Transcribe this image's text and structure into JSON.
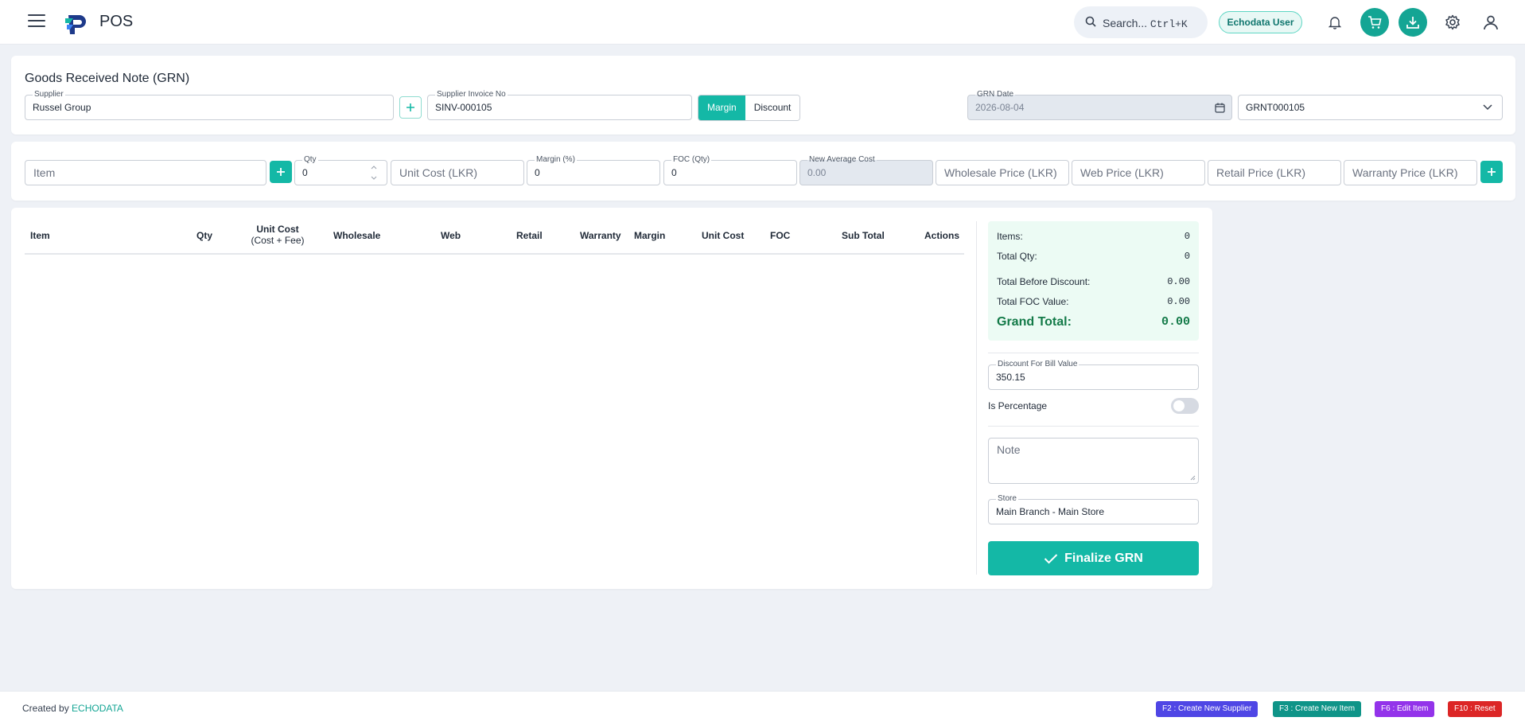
{
  "app": {
    "name": "POS"
  },
  "header": {
    "search_label": "Search...",
    "search_shortcut": "Ctrl+K",
    "user_name": "Echodata User"
  },
  "grn": {
    "title": "Goods Received Note (GRN)",
    "supplier": {
      "label": "Supplier",
      "value": "Russel Group"
    },
    "invoice": {
      "label": "Supplier Invoice No",
      "value": "SINV-000105"
    },
    "mode": {
      "options": [
        "Margin",
        "Discount"
      ],
      "selected": "Margin"
    },
    "date": {
      "label": "GRN Date",
      "value": "2026-08-04"
    },
    "grn_number": "GRNT000105"
  },
  "entry": {
    "item_placeholder": "Item",
    "qty": {
      "label": "Qty",
      "value": "0"
    },
    "unit_cost_placeholder": "Unit Cost (LKR)",
    "margin": {
      "label": "Margin (%)",
      "value": "0"
    },
    "foc": {
      "label": "FOC (Qty)",
      "value": "0"
    },
    "new_avg_cost": {
      "label": "New Average Cost",
      "value": "0.00"
    },
    "wholesale_placeholder": "Wholesale Price (LKR)",
    "web_placeholder": "Web Price (LKR)",
    "retail_placeholder": "Retail Price (LKR)",
    "warranty_placeholder": "Warranty Price (LKR)"
  },
  "table": {
    "headers": {
      "item": "Item",
      "qty": "Qty",
      "unit_cost": "Unit Cost",
      "unit_cost_sub": "(Cost + Fee)",
      "wholesale": "Wholesale",
      "web": "Web",
      "retail": "Retail",
      "warranty": "Warranty",
      "margin": "Margin",
      "unit_cost2": "Unit Cost",
      "foc": "FOC",
      "sub_total": "Sub Total",
      "actions": "Actions"
    },
    "rows": []
  },
  "summary": {
    "items_label": "Items:",
    "items_value": "0",
    "total_qty_label": "Total Qty:",
    "total_qty_value": "0",
    "before_discount_label": "Total Before Discount:",
    "before_discount_value": "0.00",
    "foc_value_label": "Total FOC Value:",
    "foc_value_value": "0.00",
    "grand_total_label": "Grand Total:",
    "grand_total_value": "0.00"
  },
  "discount": {
    "label": "Discount For Bill Value",
    "value": "350.15",
    "is_percentage_label": "Is Percentage",
    "is_percentage": false
  },
  "note_placeholder": "Note",
  "store": {
    "label": "Store",
    "value": "Main Branch - Main Store"
  },
  "finalize_label": "Finalize GRN",
  "footer": {
    "credit_prefix": "Created by",
    "credit_brand": "ECHODATA",
    "shortcuts": [
      {
        "label": "F2 : Create New Supplier",
        "color": "#4f46e5"
      },
      {
        "label": "F3 : Create New Item",
        "color": "#0f9488"
      },
      {
        "label": "F6 : Edit Item",
        "color": "#9333ea"
      },
      {
        "label": "F10 : Reset",
        "color": "#dc2626"
      }
    ]
  },
  "colors": {
    "primary": "#14b8a6",
    "summary_bg": "#ecfbf4",
    "grand_total": "#137a48"
  }
}
